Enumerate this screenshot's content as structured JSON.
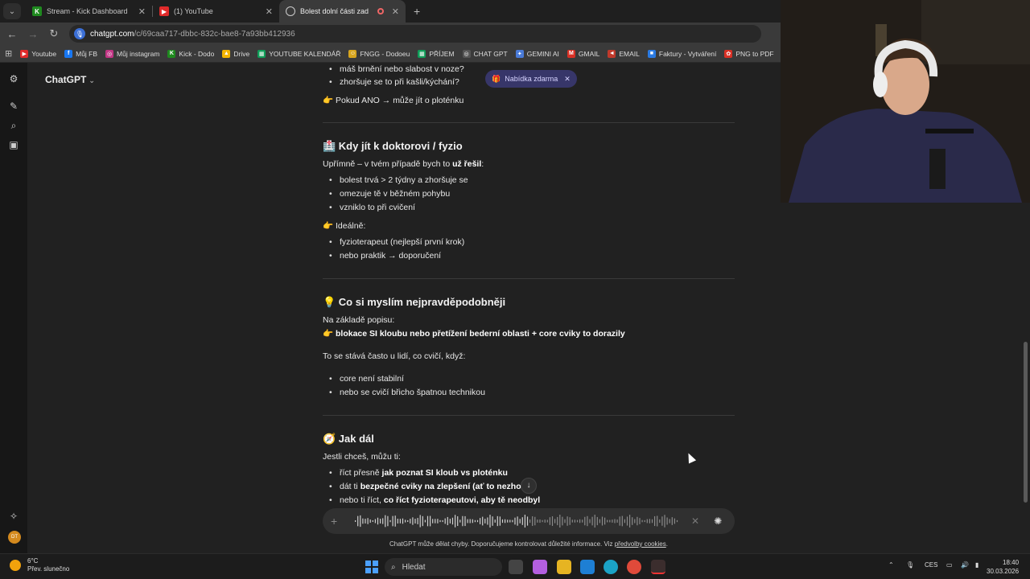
{
  "tabs": [
    {
      "title": "Stream - Kick Dashboard",
      "icon": "kick-icon"
    },
    {
      "title": "(1) YouTube",
      "icon": "youtube-icon"
    },
    {
      "title": "Bolest dolní části zad",
      "icon": "chatgpt-icon",
      "active": true
    }
  ],
  "address": {
    "domain": "chatgpt.com",
    "path": "/c/69caa717-dbbc-832c-bae8-7a93bb412936"
  },
  "bookmarks": [
    {
      "label": "Youtube",
      "color": "#e02a2a",
      "glyph": "▶"
    },
    {
      "label": "Můj FB",
      "color": "#1877f2",
      "glyph": "f"
    },
    {
      "label": "Můj instagram",
      "color": "#c13584",
      "glyph": "◎"
    },
    {
      "label": "Kick - Dodo",
      "color": "#1f8a1f",
      "glyph": "K"
    },
    {
      "label": "Drive",
      "color": "#f4b400",
      "glyph": "▲"
    },
    {
      "label": "YOUTUBE KALENDÁŘ",
      "color": "#0f9d58",
      "glyph": "▦"
    },
    {
      "label": "FNGG - Dodoeu",
      "color": "#d7a51e",
      "glyph": "☺"
    },
    {
      "label": "PŘÍJEM",
      "color": "#0f9d58",
      "glyph": "▦"
    },
    {
      "label": "CHAT GPT",
      "color": "#555555",
      "glyph": "◎"
    },
    {
      "label": "GEMINI AI",
      "color": "#4a7bd8",
      "glyph": "✦"
    },
    {
      "label": "GMAIL",
      "color": "#d93025",
      "glyph": "M"
    },
    {
      "label": "EMAIL",
      "color": "#c0392b",
      "glyph": "◄"
    },
    {
      "label": "Faktury - Vytváření",
      "color": "#2a7ae2",
      "glyph": "■"
    },
    {
      "label": "PNG to PDF",
      "color": "#d93025",
      "glyph": "✿"
    }
  ],
  "model": {
    "name": "ChatGPT"
  },
  "offer": {
    "label": "Nabídka zdarma"
  },
  "chat": {
    "top_bullets": [
      "máš brnění nebo slabost v noze?",
      "zhoršuje se to při kašli/kýchání?"
    ],
    "top_note": "👉 Pokud ANO → může jít o ploténku",
    "s1": {
      "heading": "🏥 Kdy jít k doktorovi / fyzio",
      "intro_a": "Upřímně – v tvém případě bych to ",
      "intro_b": "už řešil",
      "intro_c": ":",
      "bullets": [
        "bolest trvá > 2 týdny a zhoršuje se",
        "omezuje tě v běžném pohybu",
        "vzniklo to při cvičení"
      ],
      "ideal": "👉 Ideálně:",
      "bullets2": [
        "fyzioterapeut (nejlepší první krok)",
        "nebo praktik → doporučení"
      ]
    },
    "s2": {
      "heading": "💡 Co si myslím nejpravděpodobněji",
      "intro": "Na základě popisu:",
      "bold_line": "👉 blokace SI kloubu nebo přetížení bederní oblasti + core cviky to dorazily",
      "para": "To se stává často u lidí, co cvičí, když:",
      "bullets": [
        "core není stabilní",
        "nebo se cvičí břicho špatnou technikou"
      ]
    },
    "s3": {
      "heading": "🧭 Jak dál",
      "intro": "Jestli chceš, můžu ti:",
      "b1_a": "říct přesně ",
      "b1_b": "jak poznat SI kloub vs ploténku",
      "b2_a": "dát ti ",
      "b2_b": "bezpečné cviky na zlepšení (ať to nezhorš",
      "b3_a": "nebo ti říct, ",
      "b3_b": "co říct fyzioterapeutovi, aby tě neodbyl"
    }
  },
  "disclaimer": {
    "text": "ChatGPT může dělat chyby. Doporučujeme kontrolovat důležité informace. Viz ",
    "link": "předvolby cookies",
    "end": "."
  },
  "taskbar": {
    "temp": "6°C",
    "weather": "Přev. slunečno",
    "search": "Hledat",
    "lang": "CES",
    "time": "18:40",
    "date": "30.03.2026"
  }
}
